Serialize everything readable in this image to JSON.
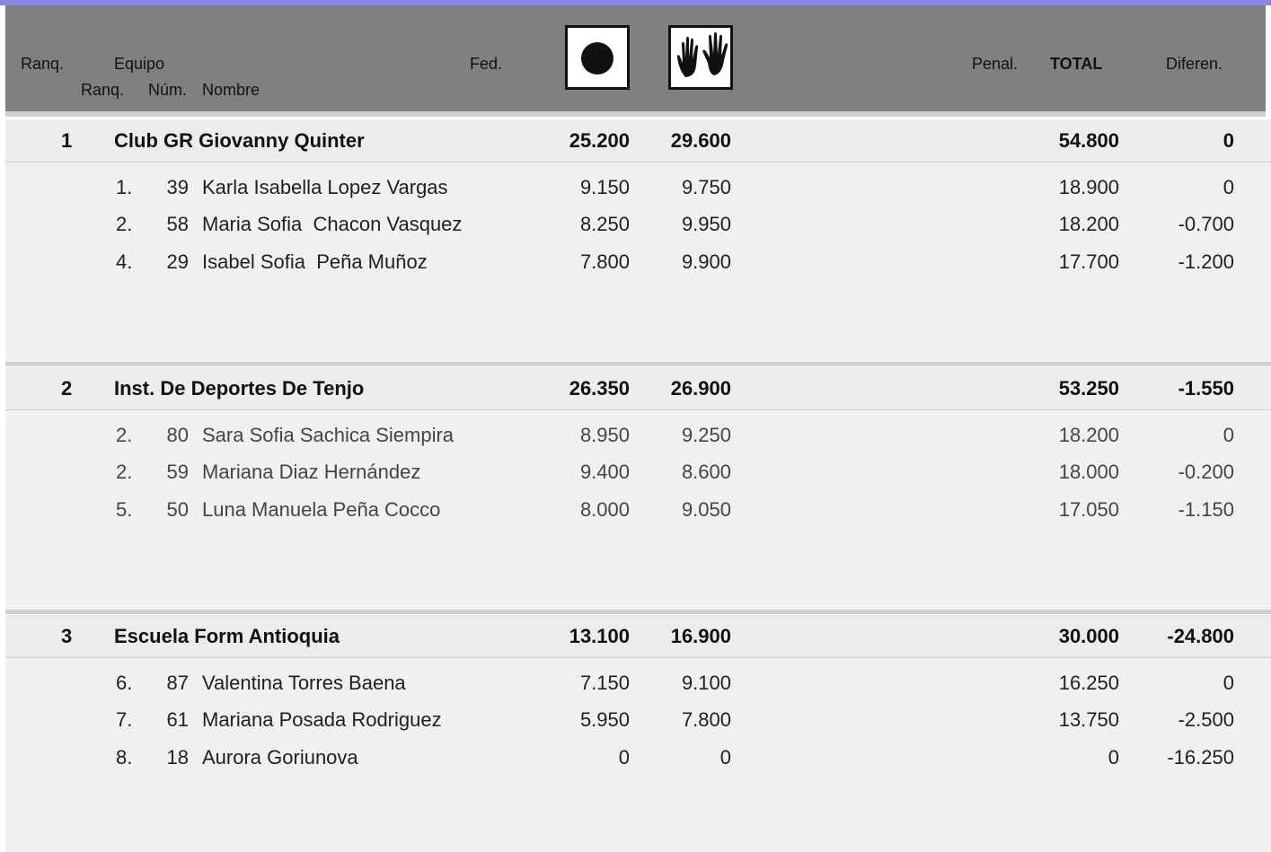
{
  "header": {
    "ranq": "Ranq.",
    "equipo": "Equipo",
    "sub_ranq": "Ranq.",
    "num": "Núm.",
    "nombre": "Nombre",
    "fed": "Fed.",
    "apparatus": [
      "ball-icon",
      "hands-icon"
    ],
    "penal": "Penal.",
    "total": "TOTAL",
    "diferen": "Diferen."
  },
  "teams": [
    {
      "rank": "1",
      "name": "Club GR Giovanny Quinter",
      "ball": "25.200",
      "hands": "29.600",
      "total": "54.800",
      "diff": "0",
      "members": [
        {
          "rank": "1.",
          "num": "39",
          "name": "Karla Isabella Lopez Vargas",
          "ball": "9.150",
          "hands": "9.750",
          "total": "18.900",
          "diff": "0"
        },
        {
          "rank": "2.",
          "num": "58",
          "name": "Maria Sofia  Chacon Vasquez",
          "ball": "8.250",
          "hands": "9.950",
          "total": "18.200",
          "diff": "-0.700"
        },
        {
          "rank": "4.",
          "num": "29",
          "name": "Isabel Sofia  Peña Muñoz",
          "ball": "7.800",
          "hands": "9.900",
          "total": "17.700",
          "diff": "-1.200"
        }
      ]
    },
    {
      "rank": "2",
      "name": "Inst. De Deportes De Tenjo",
      "ball": "26.350",
      "hands": "26.900",
      "total": "53.250",
      "diff": "-1.550",
      "members": [
        {
          "rank": "2.",
          "num": "80",
          "name": "Sara Sofia Sachica Siempira",
          "ball": "8.950",
          "hands": "9.250",
          "total": "18.200",
          "diff": "0"
        },
        {
          "rank": "2.",
          "num": "59",
          "name": "Mariana Diaz Hernández",
          "ball": "9.400",
          "hands": "8.600",
          "total": "18.000",
          "diff": "-0.200"
        },
        {
          "rank": "5.",
          "num": "50",
          "name": "Luna Manuela Peña Cocco",
          "ball": "8.000",
          "hands": "9.050",
          "total": "17.050",
          "diff": "-1.150"
        }
      ]
    },
    {
      "rank": "3",
      "name": "Escuela Form Antioquia",
      "ball": "13.100",
      "hands": "16.900",
      "total": "30.000",
      "diff": "-24.800",
      "members": [
        {
          "rank": "6.",
          "num": "87",
          "name": "Valentina Torres Baena",
          "ball": "7.150",
          "hands": "9.100",
          "total": "16.250",
          "diff": "0"
        },
        {
          "rank": "7.",
          "num": "61",
          "name": "Mariana Posada Rodriguez",
          "ball": "5.950",
          "hands": "7.800",
          "total": "13.750",
          "diff": "-2.500"
        },
        {
          "rank": "8.",
          "num": "18",
          "name": "Aurora Goriunova",
          "ball": "0",
          "hands": "0",
          "total": "0",
          "diff": "-16.250"
        }
      ]
    }
  ]
}
